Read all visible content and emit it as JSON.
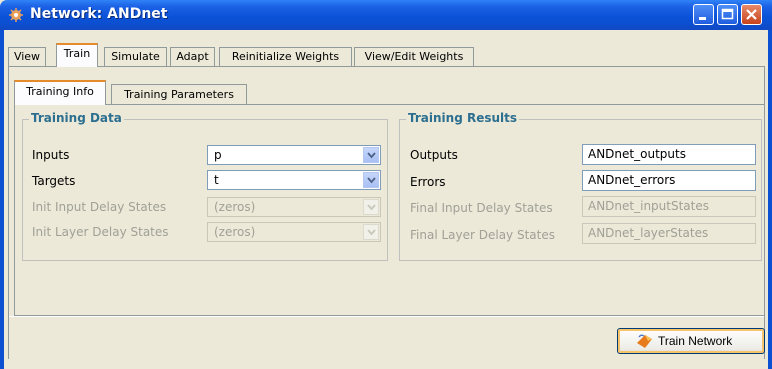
{
  "window": {
    "title": "Network: ANDnet"
  },
  "tabs": [
    {
      "label": "View"
    },
    {
      "label": "Train"
    },
    {
      "label": "Simulate"
    },
    {
      "label": "Adapt"
    },
    {
      "label": "Reinitialize Weights"
    },
    {
      "label": "View/Edit Weights"
    }
  ],
  "subtabs": [
    {
      "label": "Training Info"
    },
    {
      "label": "Training Parameters"
    }
  ],
  "training_data": {
    "legend": "Training Data",
    "inputs_label": "Inputs",
    "inputs_value": "p",
    "targets_label": "Targets",
    "targets_value": "t",
    "init_input_label": "Init Input Delay States",
    "init_input_value": "(zeros)",
    "init_layer_label": "Init Layer Delay States",
    "init_layer_value": "(zeros)"
  },
  "training_results": {
    "legend": "Training Results",
    "outputs_label": "Outputs",
    "outputs_value": "ANDnet_outputs",
    "errors_label": "Errors",
    "errors_value": "ANDnet_errors",
    "final_input_label": "Final Input Delay States",
    "final_input_value": "ANDnet_inputStates",
    "final_layer_label": "Final Layer Delay States",
    "final_layer_value": "ANDnet_layerStates"
  },
  "actions": {
    "train_label": "Train Network"
  },
  "colors": {
    "titlebar": "#0a52d8",
    "legend": "#2d6f90",
    "tab_highlight": "#e68b2c"
  }
}
